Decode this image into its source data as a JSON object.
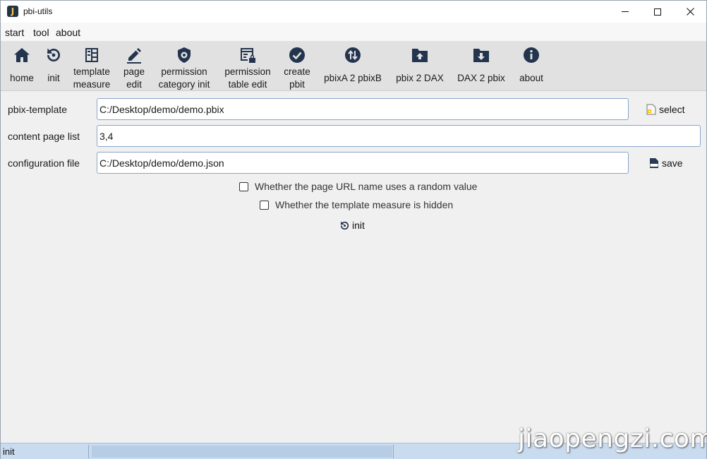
{
  "window": {
    "title": "pbi-utils",
    "app_icon_letter": "J"
  },
  "menu": {
    "items": [
      "start",
      "tool",
      "about"
    ]
  },
  "toolbar": {
    "items": [
      {
        "icon": "home-icon",
        "label": "home"
      },
      {
        "icon": "reset-icon",
        "label": "init"
      },
      {
        "icon": "table-icon",
        "label": "template\nmeasure"
      },
      {
        "icon": "pencil-icon",
        "label": "page\nedit"
      },
      {
        "icon": "shield-gear-icon",
        "label": "permission\ncategory init"
      },
      {
        "icon": "table-lock-icon",
        "label": "permission\ntable edit"
      },
      {
        "icon": "check-circle-icon",
        "label": "create\npbit"
      },
      {
        "icon": "swap-circle-icon",
        "label": "pbixA 2 pbixB"
      },
      {
        "icon": "folder-upload-icon",
        "label": "pbix 2 DAX"
      },
      {
        "icon": "folder-download-icon",
        "label": "DAX 2 pbix"
      },
      {
        "icon": "info-circle-icon",
        "label": "about"
      }
    ]
  },
  "form": {
    "pbix_template": {
      "label": "pbix-template",
      "value": "C:/Desktop/demo/demo.pbix"
    },
    "content_page_list": {
      "label": "content page list",
      "value": "3,4"
    },
    "configuration_file": {
      "label": "configuration file",
      "value": "C:/Desktop/demo/demo.json"
    },
    "select_button": "select",
    "save_button": "save",
    "options": [
      {
        "label": "Whether the page URL name uses a random value",
        "checked": false
      },
      {
        "label": "Whether the template measure is hidden",
        "checked": false
      }
    ],
    "init_button": "init"
  },
  "statusbar": {
    "text": "init"
  },
  "watermark": "jiaopengzi.com",
  "colors": {
    "icon": "#23344e",
    "toolbar_bg": "#e1e1e1",
    "input_border": "#8aa6c8",
    "status_bg": "#c9dbef"
  }
}
